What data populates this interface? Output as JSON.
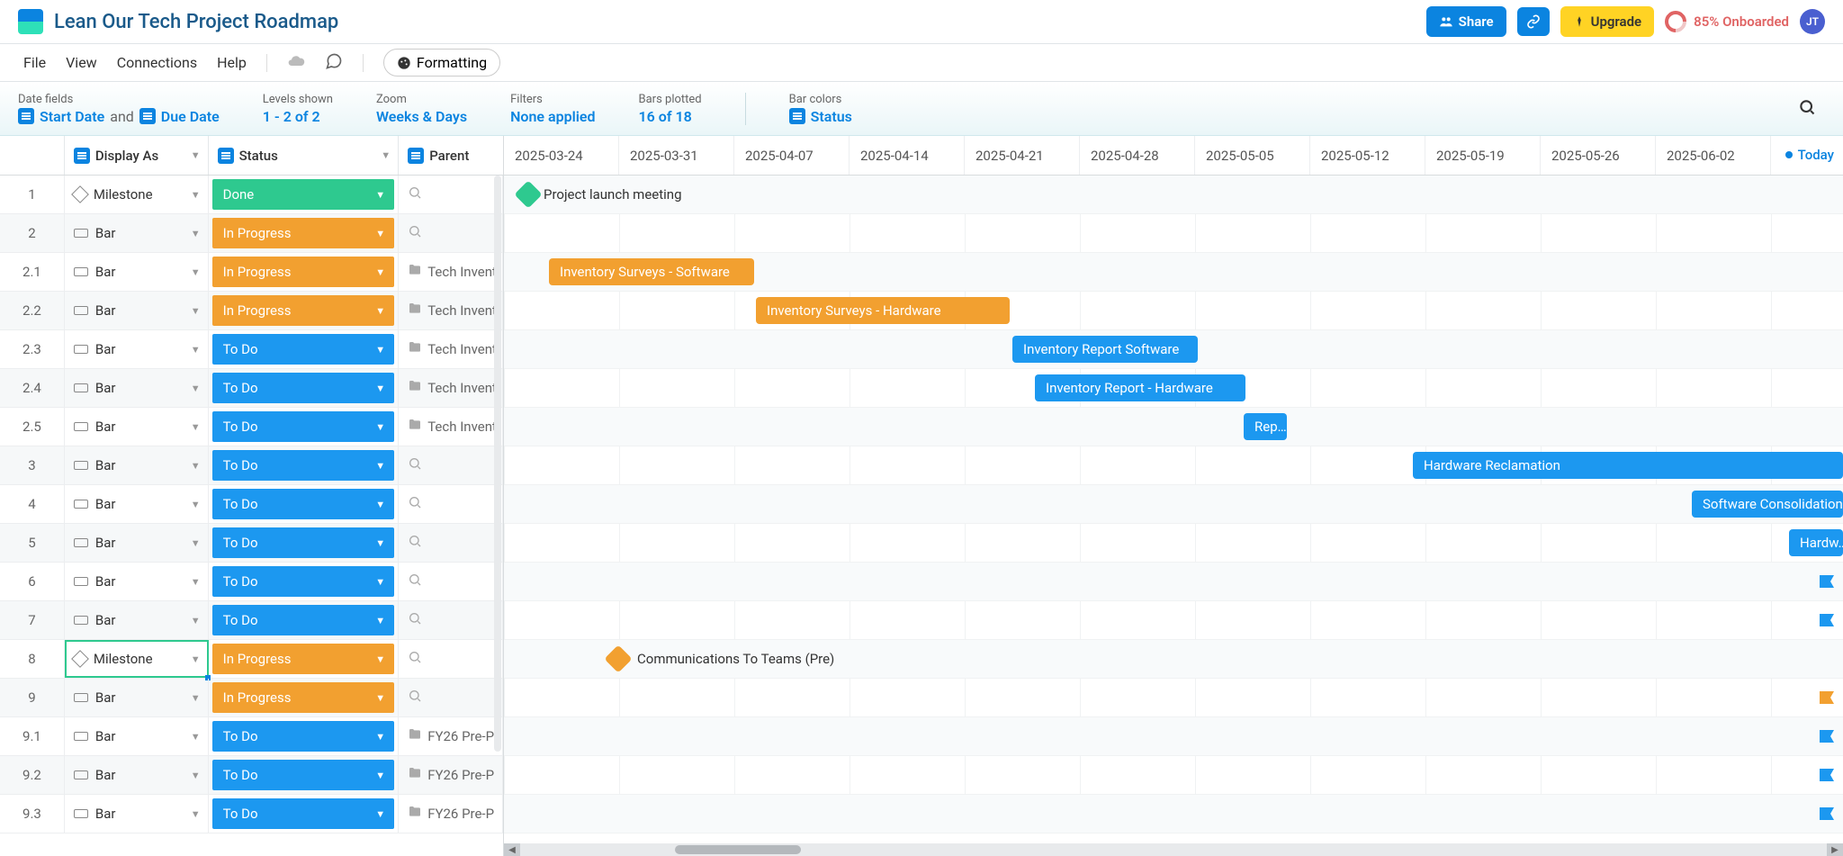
{
  "title": "Lean Our Tech Project Roadmap",
  "menu": {
    "file": "File",
    "view": "View",
    "connections": "Connections",
    "help": "Help",
    "formatting": "Formatting"
  },
  "topbar": {
    "share": "Share",
    "upgrade": "Upgrade",
    "onboard": "85% Onboarded",
    "avatar": "JT"
  },
  "config": {
    "dateFieldsLabel": "Date fields",
    "startDate": "Start Date",
    "and": "and",
    "dueDate": "Due Date",
    "levelsLabel": "Levels shown",
    "levels": "1 - 2 of 2",
    "zoomLabel": "Zoom",
    "zoom": "Weeks & Days",
    "filtersLabel": "Filters",
    "filters": "None applied",
    "barsLabel": "Bars plotted",
    "bars": "16 of 18",
    "colorsLabel": "Bar colors",
    "colors": "Status"
  },
  "headers": {
    "display": "Display As",
    "status": "Status",
    "parent": "Parent"
  },
  "today": "Today",
  "dates": [
    "2025-03-24",
    "2025-03-31",
    "2025-04-07",
    "2025-04-14",
    "2025-04-21",
    "2025-04-28",
    "2025-05-05",
    "2025-05-12",
    "2025-05-19",
    "2025-05-26",
    "2025-06-02"
  ],
  "statusLabels": {
    "done": "Done",
    "progress": "In Progress",
    "todo": "To Do"
  },
  "rows": [
    {
      "n": "1",
      "display": "Milestone",
      "status": "done",
      "parent": "",
      "ptype": "search"
    },
    {
      "n": "2",
      "display": "Bar",
      "status": "progress",
      "parent": "",
      "ptype": "search"
    },
    {
      "n": "2.1",
      "display": "Bar",
      "status": "progress",
      "parent": "Tech Invent",
      "ptype": "folder"
    },
    {
      "n": "2.2",
      "display": "Bar",
      "status": "progress",
      "parent": "Tech Invent",
      "ptype": "folder"
    },
    {
      "n": "2.3",
      "display": "Bar",
      "status": "todo",
      "parent": "Tech Invent",
      "ptype": "folder"
    },
    {
      "n": "2.4",
      "display": "Bar",
      "status": "todo",
      "parent": "Tech Invent",
      "ptype": "folder"
    },
    {
      "n": "2.5",
      "display": "Bar",
      "status": "todo",
      "parent": "Tech Invent",
      "ptype": "folder"
    },
    {
      "n": "3",
      "display": "Bar",
      "status": "todo",
      "parent": "",
      "ptype": "search"
    },
    {
      "n": "4",
      "display": "Bar",
      "status": "todo",
      "parent": "",
      "ptype": "search"
    },
    {
      "n": "5",
      "display": "Bar",
      "status": "todo",
      "parent": "",
      "ptype": "search"
    },
    {
      "n": "6",
      "display": "Bar",
      "status": "todo",
      "parent": "",
      "ptype": "search"
    },
    {
      "n": "7",
      "display": "Bar",
      "status": "todo",
      "parent": "",
      "ptype": "search"
    },
    {
      "n": "8",
      "display": "Milestone",
      "status": "progress",
      "parent": "",
      "ptype": "search"
    },
    {
      "n": "9",
      "display": "Bar",
      "status": "progress",
      "parent": "",
      "ptype": "search"
    },
    {
      "n": "9.1",
      "display": "Bar",
      "status": "todo",
      "parent": "FY26 Pre-P",
      "ptype": "folder"
    },
    {
      "n": "9.2",
      "display": "Bar",
      "status": "todo",
      "parent": "FY26 Pre-P",
      "ptype": "folder"
    },
    {
      "n": "9.3",
      "display": "Bar",
      "status": "todo",
      "parent": "FY26 Pre-P",
      "ptype": "folder"
    }
  ],
  "bars": {
    "projectLaunch": "Project launch meeting",
    "invSw": "Inventory Surveys - Software",
    "invHw": "Inventory Surveys - Hardware",
    "repSw": "Inventory Report Software",
    "repHw": "Inventory Report - Hardware",
    "repShort": "Rep…",
    "hwRecl": "Hardware Reclamation",
    "swCons": "Software Consolidation",
    "hwShort": "Hardw…",
    "comms": "Communications To Teams (Pre)"
  }
}
